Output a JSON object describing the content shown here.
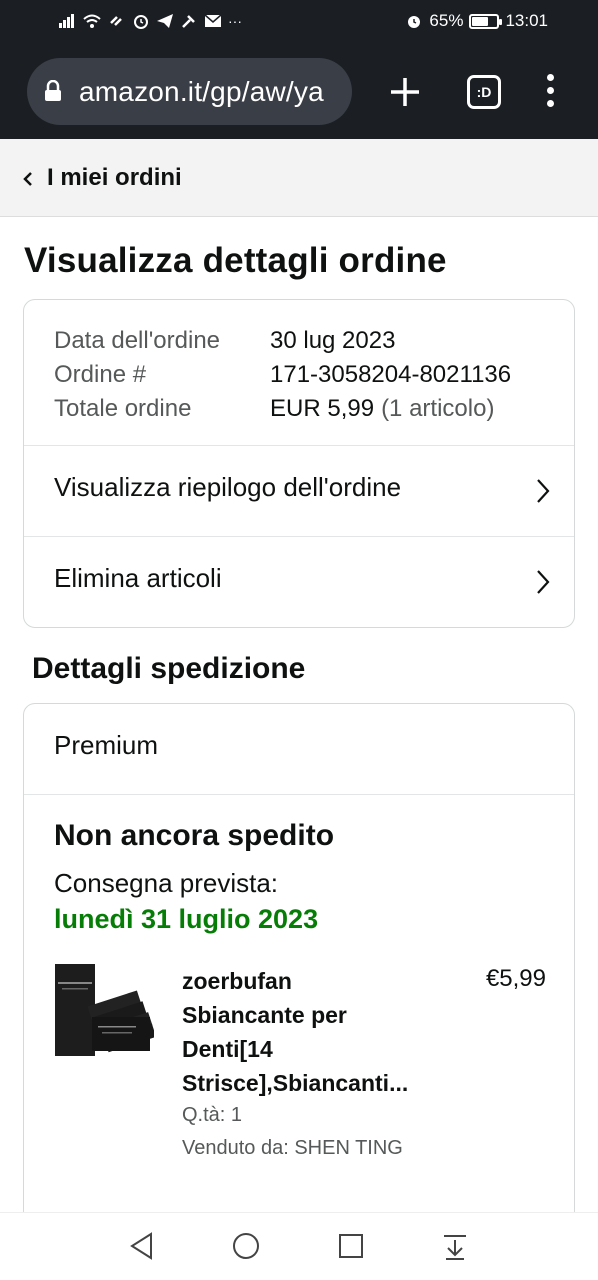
{
  "status_bar": {
    "battery_percent": "65%",
    "battery_level": 0.65,
    "time": "13:01",
    "more": "···"
  },
  "browser": {
    "url": "amazon.it/gp/aw/ya",
    "tabs_button": ":D"
  },
  "subnav": {
    "back_label": "I miei ordini"
  },
  "page": {
    "title": "Visualizza dettagli ordine"
  },
  "order_info": {
    "rows": [
      {
        "label": "Data dell'ordine",
        "value": "30 lug 2023",
        "suffix": ""
      },
      {
        "label": "Ordine #",
        "value": "171-3058204-8021136",
        "suffix": ""
      },
      {
        "label": "Totale ordine",
        "value": "EUR 5,99",
        "suffix": "(1 articolo)"
      }
    ],
    "links": [
      {
        "label": "Visualizza riepilogo dell'ordine"
      },
      {
        "label": "Elimina articoli"
      }
    ]
  },
  "shipping": {
    "section_title": "Dettagli spedizione",
    "method": "Premium",
    "status": "Non ancora spedito",
    "delivery_label": "Consegna prevista:",
    "delivery_date": "lunedì 31 luglio 2023",
    "item": {
      "name_lines": [
        "zoerbufan",
        "Sbiancante per",
        "Denti[14",
        "Strisce],Sbiancanti..."
      ],
      "price": "€5,99",
      "qty": "Q.tà: 1",
      "seller": "Venduto da: SHEN TING"
    }
  },
  "colors": {
    "delivery_green": "#067d06",
    "chrome": "#1b1f24"
  }
}
